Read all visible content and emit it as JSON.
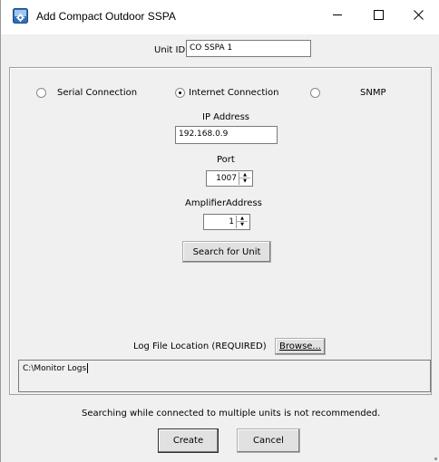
{
  "window": {
    "title": "Add Compact Outdoor SSPA",
    "icon": "app-settings-icon",
    "controls": {
      "minimize": "minimize-icon",
      "maximize": "maximize-icon",
      "close": "close-icon"
    }
  },
  "unit_id": {
    "label": "Unit ID:",
    "value": "CO SSPA 1"
  },
  "connection": {
    "serial_label": "Serial Connection",
    "internet_label": "Internet Connection",
    "snmp_label": "SNMP",
    "selected": "Internet Connection"
  },
  "ip": {
    "label": "IP Address",
    "value": "192.168.0.9"
  },
  "port": {
    "label": "Port",
    "value": "1007"
  },
  "amplifier": {
    "label": "AmplifierAddress",
    "value": "1"
  },
  "search_button": "Search for Unit",
  "log": {
    "label": "Log File Location (REQUIRED)",
    "browse_label": "Browse...",
    "path": "C:\\Monitor Logs"
  },
  "warning": "Searching while connected to multiple units is not recommended.",
  "footer": {
    "create_label": "Create",
    "cancel_label": "Cancel"
  }
}
